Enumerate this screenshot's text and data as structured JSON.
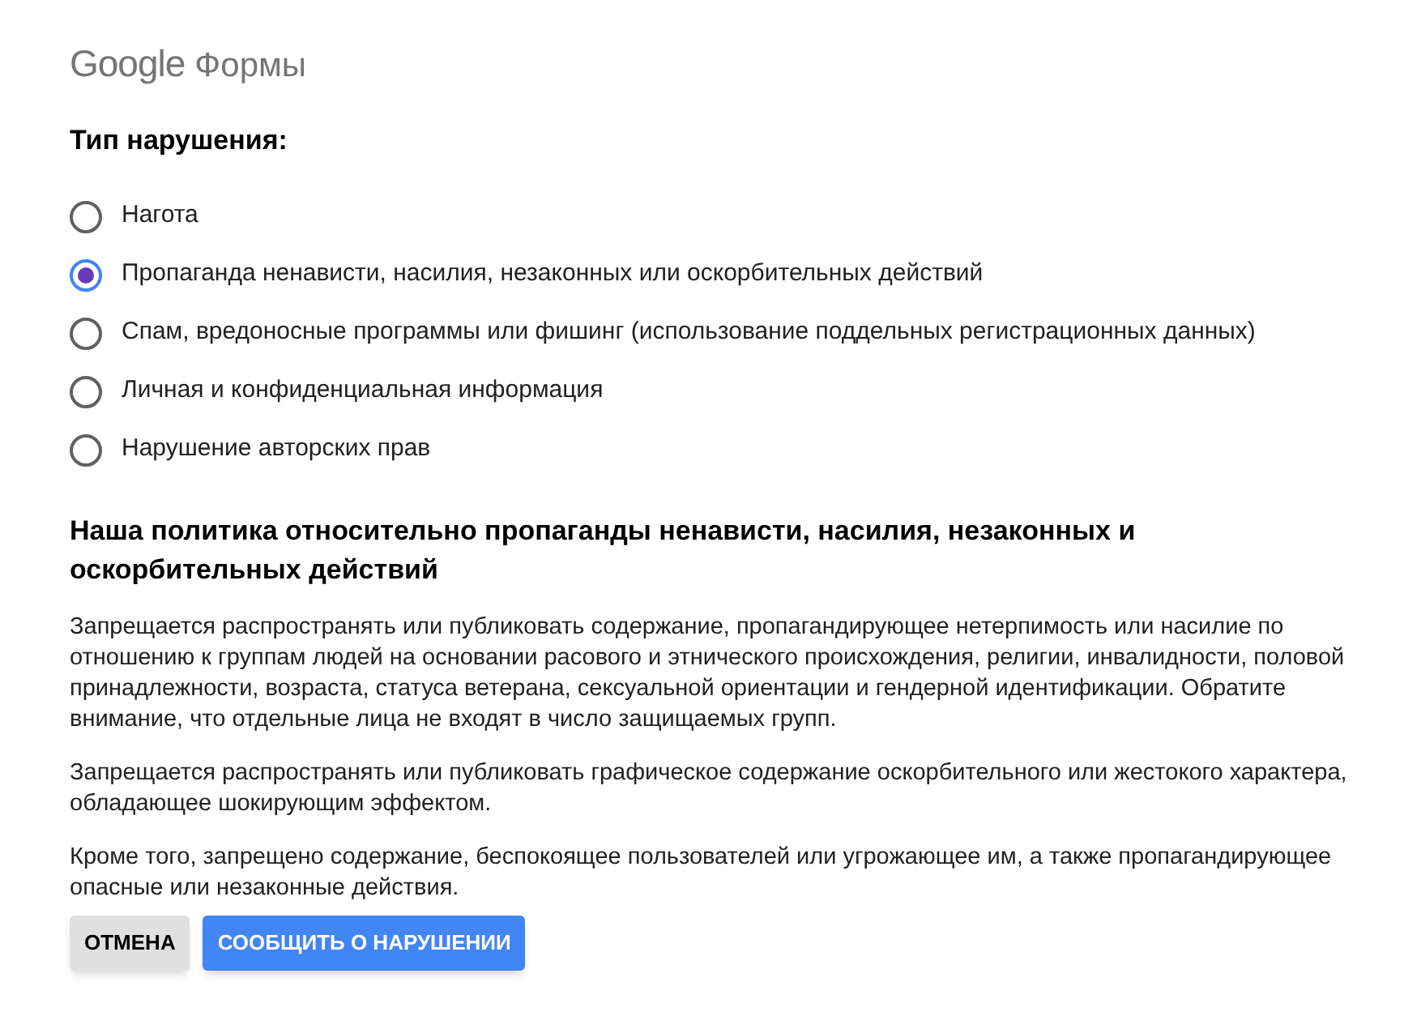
{
  "header": {
    "brand": "Google",
    "product": "Формы"
  },
  "question": {
    "title": "Тип нарушения:",
    "options": [
      {
        "label": "Нагота",
        "selected": false
      },
      {
        "label": "Пропаганда ненависти, насилия, незаконных или оскорбительных действий",
        "selected": true
      },
      {
        "label": "Спам, вредоносные программы или фишинг (использование поддельных регистрационных данных)",
        "selected": false
      },
      {
        "label": "Личная и конфиденциальная информация",
        "selected": false
      },
      {
        "label": "Нарушение авторских прав",
        "selected": false
      }
    ]
  },
  "policy": {
    "title": "Наша политика относительно пропаганды ненависти, насилия, незаконных и оскорбительных действий",
    "paragraphs": [
      "Запрещается распространять или публиковать содержание, пропагандирующее нетерпимость или насилие по отношению к группам людей на основании расового и этнического происхождения, религии, инвалидности, половой принадлежности, возраста, статуса ветерана, сексуальной ориентации и гендерной идентификации. Обратите внимание, что отдельные лица не входят в число защищаемых групп.",
      "Запрещается распространять или публиковать графическое содержание оскорбительного или жестокого характера, обладающее шокирующим эффектом.",
      "Кроме того, запрещено содержание, беспокоящее пользователей или угрожающее им, а также пропагандирующее опасные или незаконные действия."
    ]
  },
  "buttons": [
    {
      "label": "ОТМЕНА",
      "kind": "secondary"
    },
    {
      "label": "СООБЩИТЬ О НАРУШЕНИИ",
      "kind": "primary"
    }
  ]
}
